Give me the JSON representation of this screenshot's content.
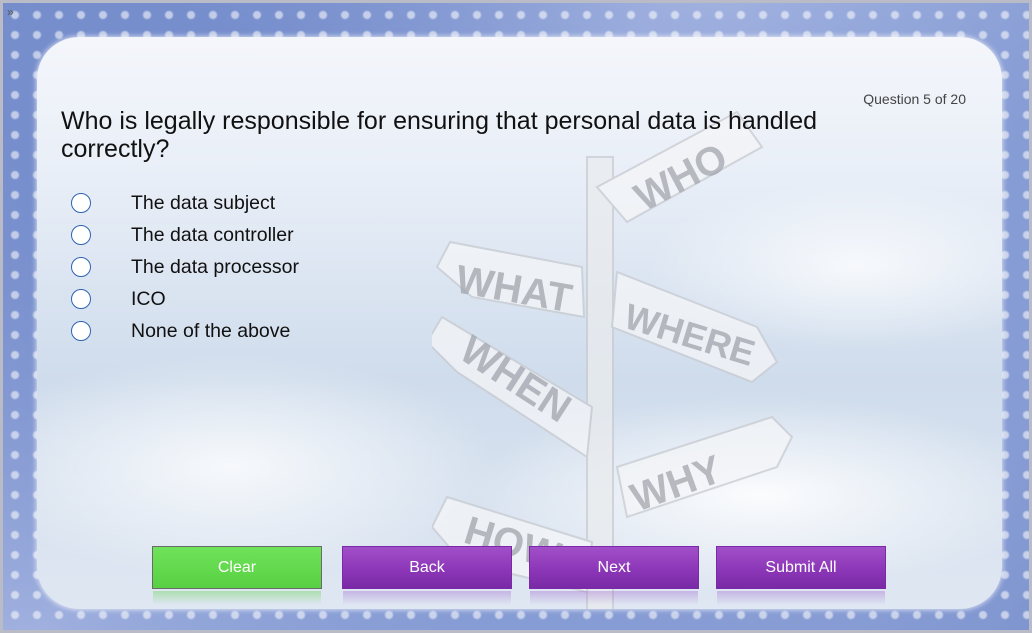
{
  "question": {
    "counter": "Question 5 of 20",
    "text": "Who is legally responsible for ensuring that personal data is handled correctly?"
  },
  "options": [
    {
      "label": "The data subject",
      "selected": false
    },
    {
      "label": "The data controller",
      "selected": false
    },
    {
      "label": "The data processor",
      "selected": false
    },
    {
      "label": "ICO",
      "selected": false
    },
    {
      "label": "None of the above",
      "selected": false
    }
  ],
  "buttons": {
    "clear": "Clear",
    "back": "Back",
    "next": "Next",
    "submit_all": "Submit All"
  },
  "signpost": {
    "who": "WHO",
    "what": "WHAT",
    "where": "WHERE",
    "when": "WHEN",
    "why": "WHY",
    "how": "HOW"
  },
  "toggle": "»",
  "colors": {
    "clear_button": "#66dd50",
    "nav_button": "#8e3bb9",
    "radio_border": "#2c63b5"
  }
}
